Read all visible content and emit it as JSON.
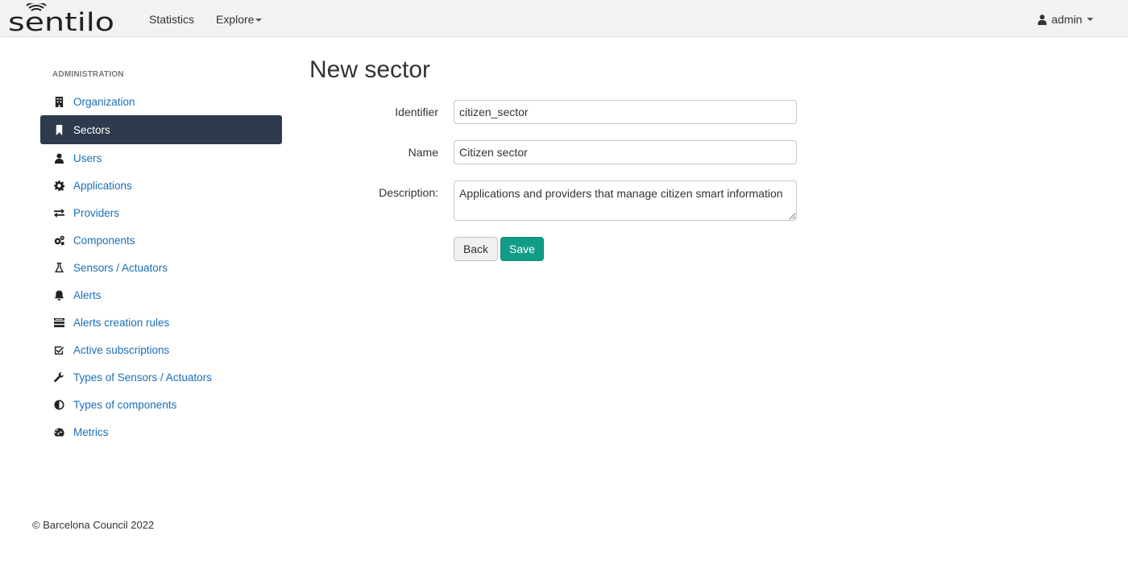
{
  "brand": {
    "logo_text": "sentilo"
  },
  "nav": {
    "statistics": "Statistics",
    "explore": "Explore",
    "user": "admin"
  },
  "sidebar": {
    "heading": "ADMINISTRATION",
    "items": [
      {
        "label": "Organization",
        "icon": "building-icon"
      },
      {
        "label": "Sectors",
        "icon": "bookmark-icon",
        "active": true
      },
      {
        "label": "Users",
        "icon": "user-icon"
      },
      {
        "label": "Applications",
        "icon": "gear-icon"
      },
      {
        "label": "Providers",
        "icon": "exchange-icon"
      },
      {
        "label": "Components",
        "icon": "gears-icon"
      },
      {
        "label": "Sensors / Actuators",
        "icon": "flask-icon"
      },
      {
        "label": "Alerts",
        "icon": "bell-icon"
      },
      {
        "label": "Alerts creation rules",
        "icon": "list-icon"
      },
      {
        "label": "Active subscriptions",
        "icon": "check-square-icon"
      },
      {
        "label": "Types of Sensors / Actuators",
        "icon": "wrench-icon"
      },
      {
        "label": "Types of components",
        "icon": "half-circle-icon"
      },
      {
        "label": "Metrics",
        "icon": "dashboard-icon"
      }
    ]
  },
  "main": {
    "title": "New sector",
    "form": {
      "identifier_label": "Identifier",
      "identifier_value": "citizen_sector",
      "name_label": "Name",
      "name_value": "Citizen sector",
      "description_label": "Description:",
      "description_value": "Applications and providers that manage citizen smart information"
    },
    "buttons": {
      "back": "Back",
      "save": "Save"
    }
  },
  "footer": {
    "copyright": "© Barcelona Council 2022"
  },
  "colors": {
    "accent": "#119c87",
    "sidebar_active": "#2e3b4c",
    "link": "#1a6fb5"
  }
}
